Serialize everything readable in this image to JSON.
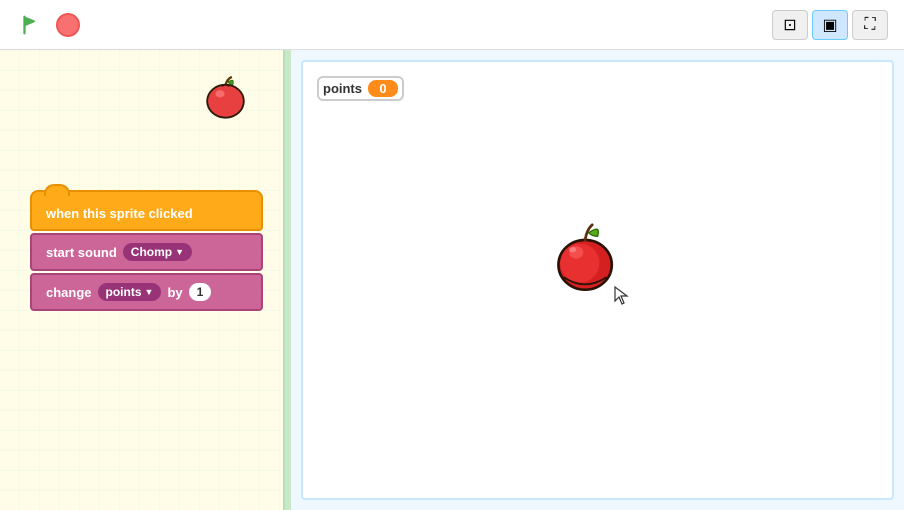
{
  "topbar": {
    "flag_label": "▶",
    "stop_label": "",
    "view_buttons": [
      {
        "id": "sidebar-view",
        "icon": "⊞",
        "active": false
      },
      {
        "id": "stage-view",
        "icon": "▣",
        "active": true
      },
      {
        "id": "fullscreen-view",
        "icon": "⛶",
        "active": false
      }
    ]
  },
  "stage": {
    "variable": {
      "name": "points",
      "value": "0"
    }
  },
  "blocks": {
    "event_block": "when this sprite clicked",
    "sound_block_prefix": "start sound",
    "sound_name": "Chomp",
    "variable_block_prefix": "change",
    "variable_name": "points",
    "variable_by": "by",
    "variable_amount": "1"
  }
}
